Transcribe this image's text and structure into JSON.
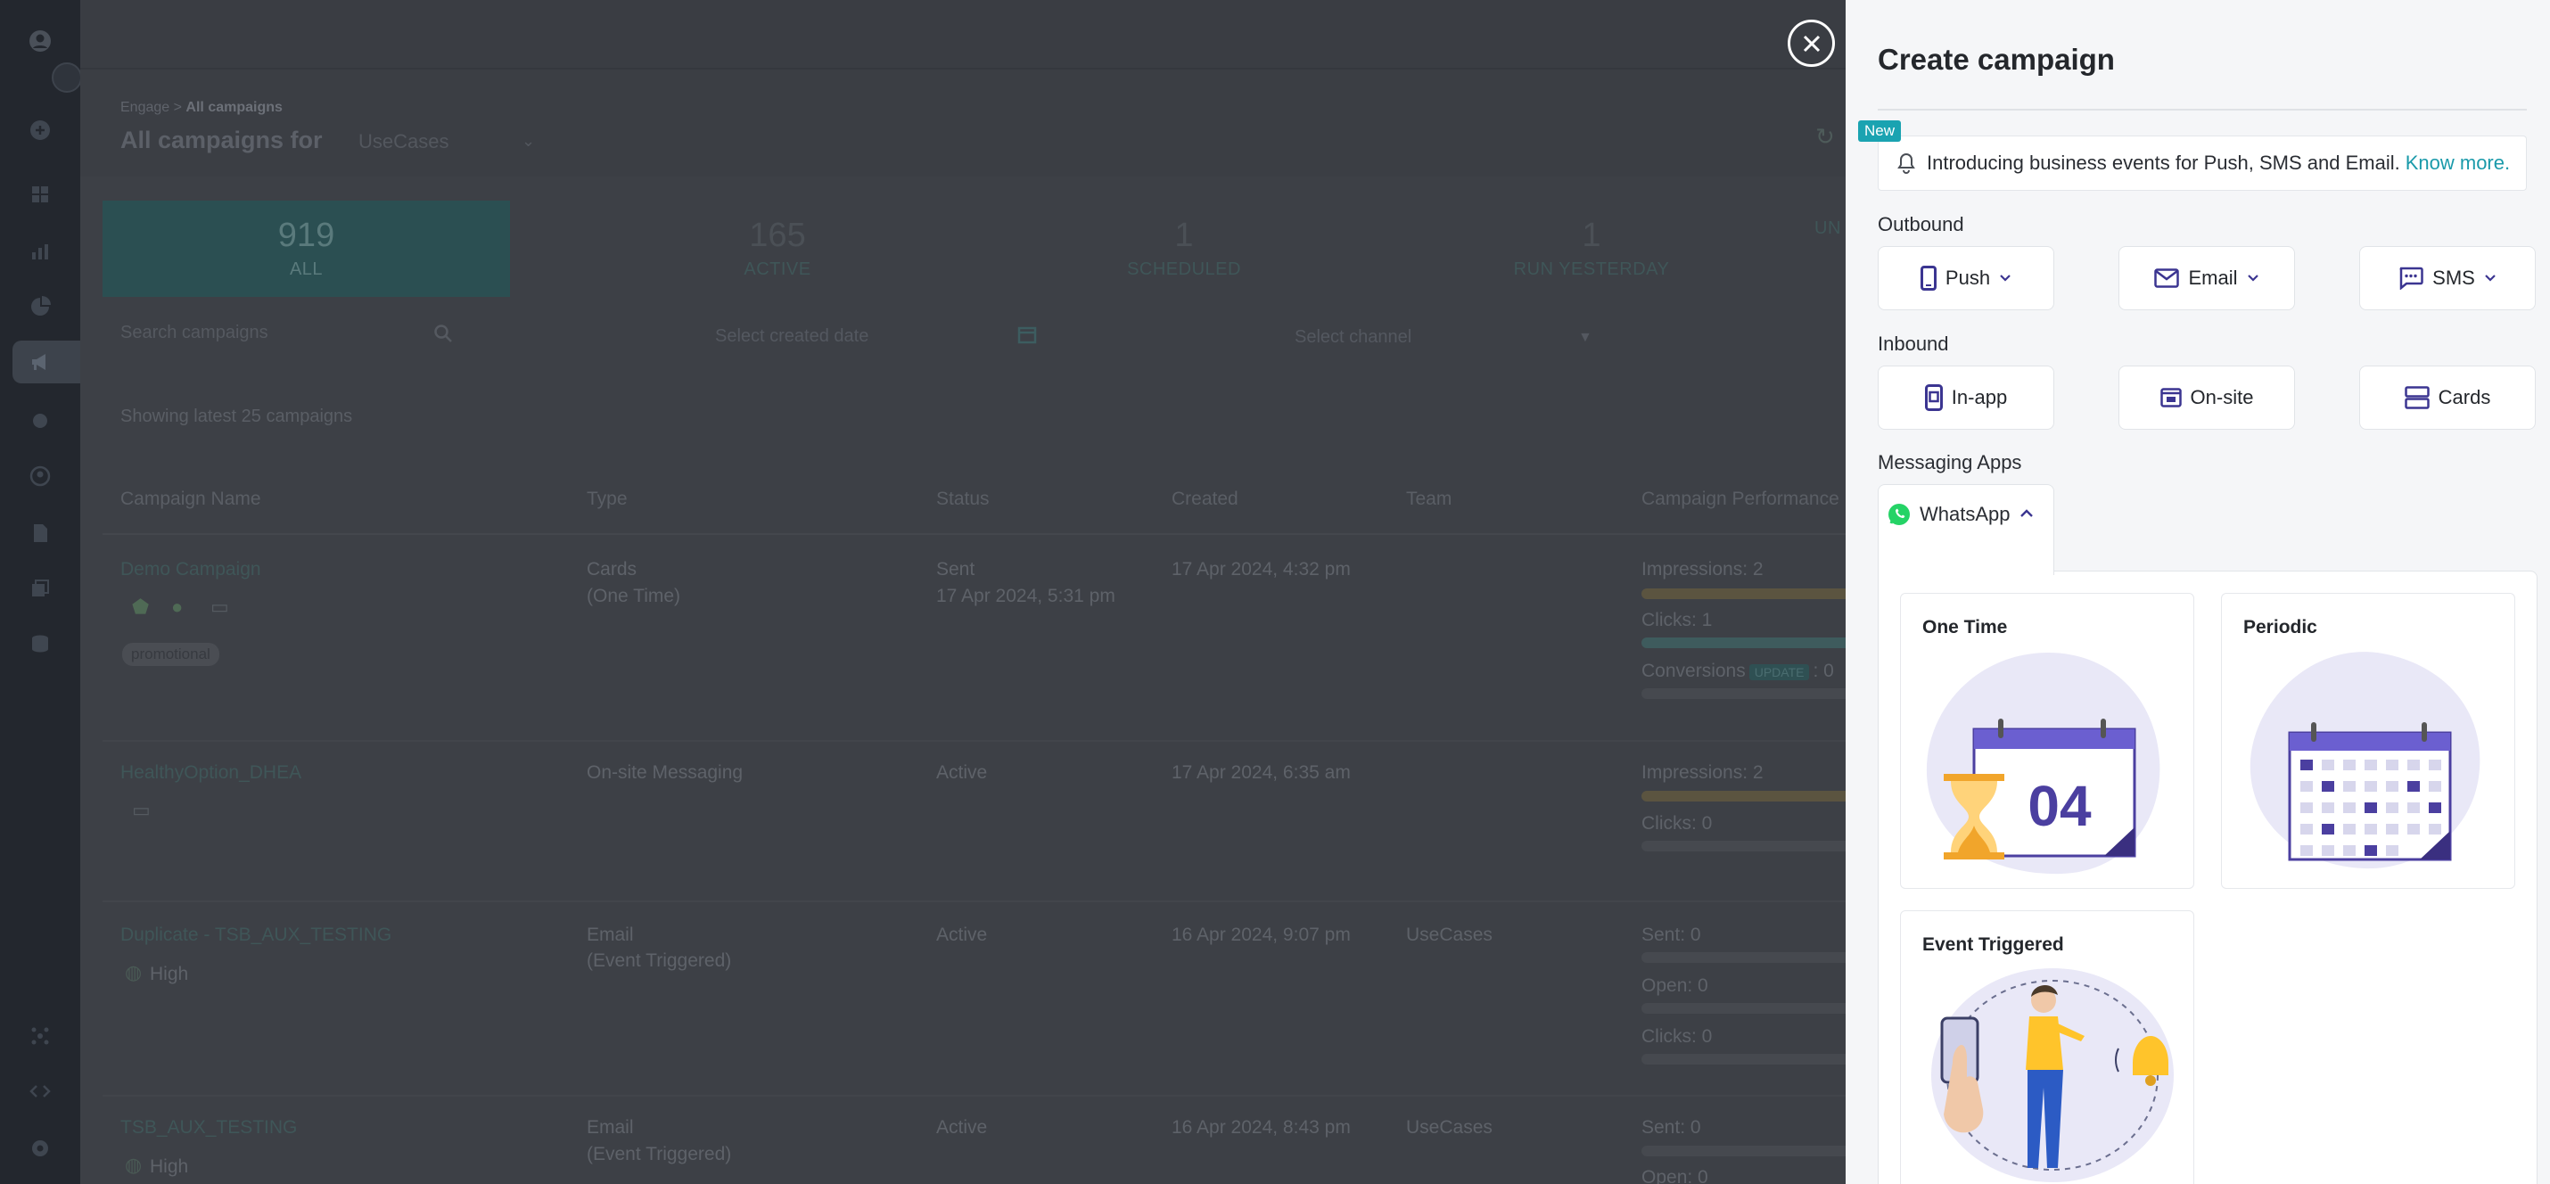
{
  "background": {
    "breadcrumb": {
      "parent": "Engage",
      "separator": ">",
      "current": "All campaigns"
    },
    "title": "All campaigns for",
    "account": "UseCases",
    "stats": [
      {
        "num": "919",
        "label": "ALL"
      },
      {
        "num": "165",
        "label": "ACTIVE"
      },
      {
        "num": "1",
        "label": "SCHEDULED"
      },
      {
        "num": "1",
        "label": "RUN YESTERDAY"
      },
      {
        "num": "",
        "label": "UN"
      }
    ],
    "filters": {
      "search_placeholder": "Search campaigns",
      "date_placeholder": "Select created date",
      "channel_placeholder": "Select channel"
    },
    "showing": "Showing latest 25 campaigns",
    "columns": [
      "Campaign Name",
      "Type",
      "Status",
      "Created",
      "Team",
      "Campaign Performance"
    ],
    "rows": [
      {
        "name": "Demo Campaign",
        "type1": "Cards",
        "type2": "(One Time)",
        "status1": "Sent",
        "status2": "17 Apr 2024, 5:31 pm",
        "created": "17 Apr 2024, 4:32 pm",
        "team": "",
        "tag": "promotional",
        "perf": [
          "Impressions: 2",
          "Clicks: 1",
          "Conversions",
          ": 0"
        ],
        "update_badge": "UPDATE"
      },
      {
        "name": "HealthyOption_DHEA",
        "type1": "On-site Messaging",
        "type2": "",
        "status1": "Active",
        "status2": "",
        "created": "17 Apr 2024, 6:35 am",
        "team": "",
        "perf": [
          "Impressions: 2",
          "Clicks: 0"
        ]
      },
      {
        "name": "Duplicate - TSB_AUX_TESTING",
        "type1": "Email",
        "type2": "(Event Triggered)",
        "status1": "Active",
        "status2": "",
        "created": "16 Apr 2024, 9:07 pm",
        "team": "UseCases",
        "priority": "High",
        "perf": [
          "Sent: 0",
          "Open: 0",
          "Clicks: 0"
        ]
      },
      {
        "name": "TSB_AUX_TESTING",
        "type1": "Email",
        "type2": "(Event Triggered)",
        "status1": "Active",
        "status2": "",
        "created": "16 Apr 2024, 8:43 pm",
        "team": "UseCases",
        "priority": "High",
        "perf": [
          "Sent: 0",
          "Open: 0"
        ]
      }
    ]
  },
  "drawer": {
    "title": "Create campaign",
    "new_badge": "New",
    "notice_text": "Introducing business events for Push, SMS and Email.",
    "notice_link": "Know more.",
    "outbound_label": "Outbound",
    "outbound": [
      {
        "label": "Push",
        "icon": "phone-icon"
      },
      {
        "label": "Email",
        "icon": "envelope-icon"
      },
      {
        "label": "SMS",
        "icon": "chat-icon"
      }
    ],
    "inbound_label": "Inbound",
    "inbound": [
      {
        "label": "In-app",
        "icon": "inapp-icon"
      },
      {
        "label": "On-site",
        "icon": "onsite-icon"
      },
      {
        "label": "Cards",
        "icon": "cards-icon"
      }
    ],
    "messaging_label": "Messaging Apps",
    "whatsapp": "WhatsApp",
    "types": [
      {
        "title": "One Time",
        "art": "04"
      },
      {
        "title": "Periodic"
      },
      {
        "title": "Event Triggered"
      }
    ]
  },
  "colors": {
    "accent": "#1a9aaa",
    "brand_purple": "#4b3fa0",
    "whatsapp_green": "#25d366",
    "overlay_dark": "#23272e"
  }
}
